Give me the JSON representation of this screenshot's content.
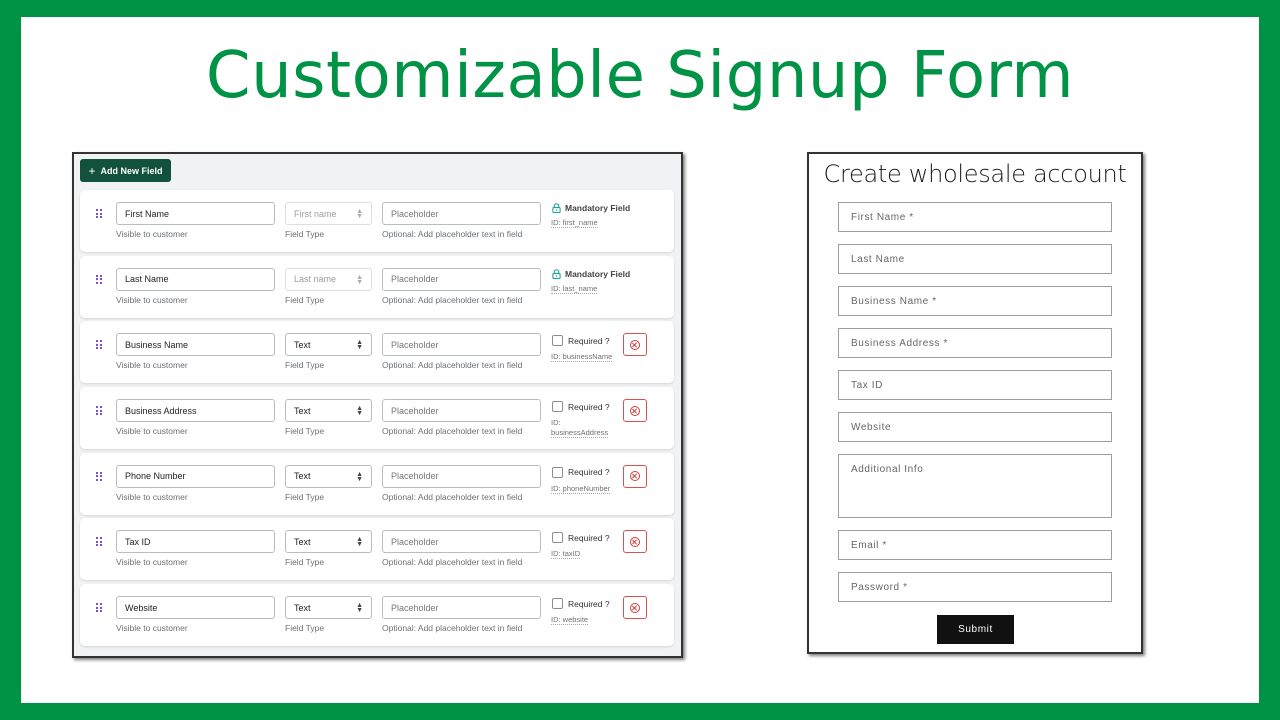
{
  "title": "Customizable Signup Form",
  "colors": {
    "brand_green": "#009245",
    "button_dark_green": "#12513b",
    "delete_red": "#d9534f",
    "mandatory_lock_teal": "#1aa39a",
    "drag_purple": "#7a4fd6"
  },
  "admin": {
    "add_button": {
      "icon": "plus-icon",
      "label": "Add New Field"
    },
    "help_labels": {
      "name": "Visible to customer",
      "type": "Field Type",
      "placeholder": "Optional: Add placeholder text in field"
    },
    "placeholder_input_value": "Placeholder",
    "mandatory_label": "Mandatory Field",
    "required_label": "Required ?",
    "fields": [
      {
        "name": "First Name",
        "type": "First name",
        "type_disabled": true,
        "mandatory": true,
        "id": "ID: first_name"
      },
      {
        "name": "Last Name",
        "type": "Last name",
        "type_disabled": true,
        "mandatory": true,
        "id": "ID: last_name"
      },
      {
        "name": "Business Name",
        "type": "Text",
        "type_disabled": false,
        "mandatory": false,
        "required": false,
        "id": "ID: businessName"
      },
      {
        "name": "Business Address",
        "type": "Text",
        "type_disabled": false,
        "mandatory": false,
        "required": false,
        "id": "ID: businessAddress"
      },
      {
        "name": "Phone Number",
        "type": "Text",
        "type_disabled": false,
        "mandatory": false,
        "required": false,
        "id": "ID: phoneNumber"
      },
      {
        "name": "Tax ID",
        "type": "Text",
        "type_disabled": false,
        "mandatory": false,
        "required": false,
        "id": "ID: taxID"
      },
      {
        "name": "Website",
        "type": "Text",
        "type_disabled": false,
        "mandatory": false,
        "required": false,
        "id": "ID: website"
      }
    ]
  },
  "preview": {
    "title": "Create wholesale account",
    "fields": [
      {
        "placeholder": "First Name *",
        "type": "input"
      },
      {
        "placeholder": "Last Name",
        "type": "input"
      },
      {
        "placeholder": "Business Name *",
        "type": "input"
      },
      {
        "placeholder": "Business Address *",
        "type": "input"
      },
      {
        "placeholder": "Tax ID",
        "type": "input"
      },
      {
        "placeholder": "Website",
        "type": "input"
      },
      {
        "placeholder": "Additional Info",
        "type": "textarea"
      },
      {
        "placeholder": "Email *",
        "type": "input"
      },
      {
        "placeholder": "Password *",
        "type": "input"
      }
    ],
    "submit_label": "Submit"
  }
}
